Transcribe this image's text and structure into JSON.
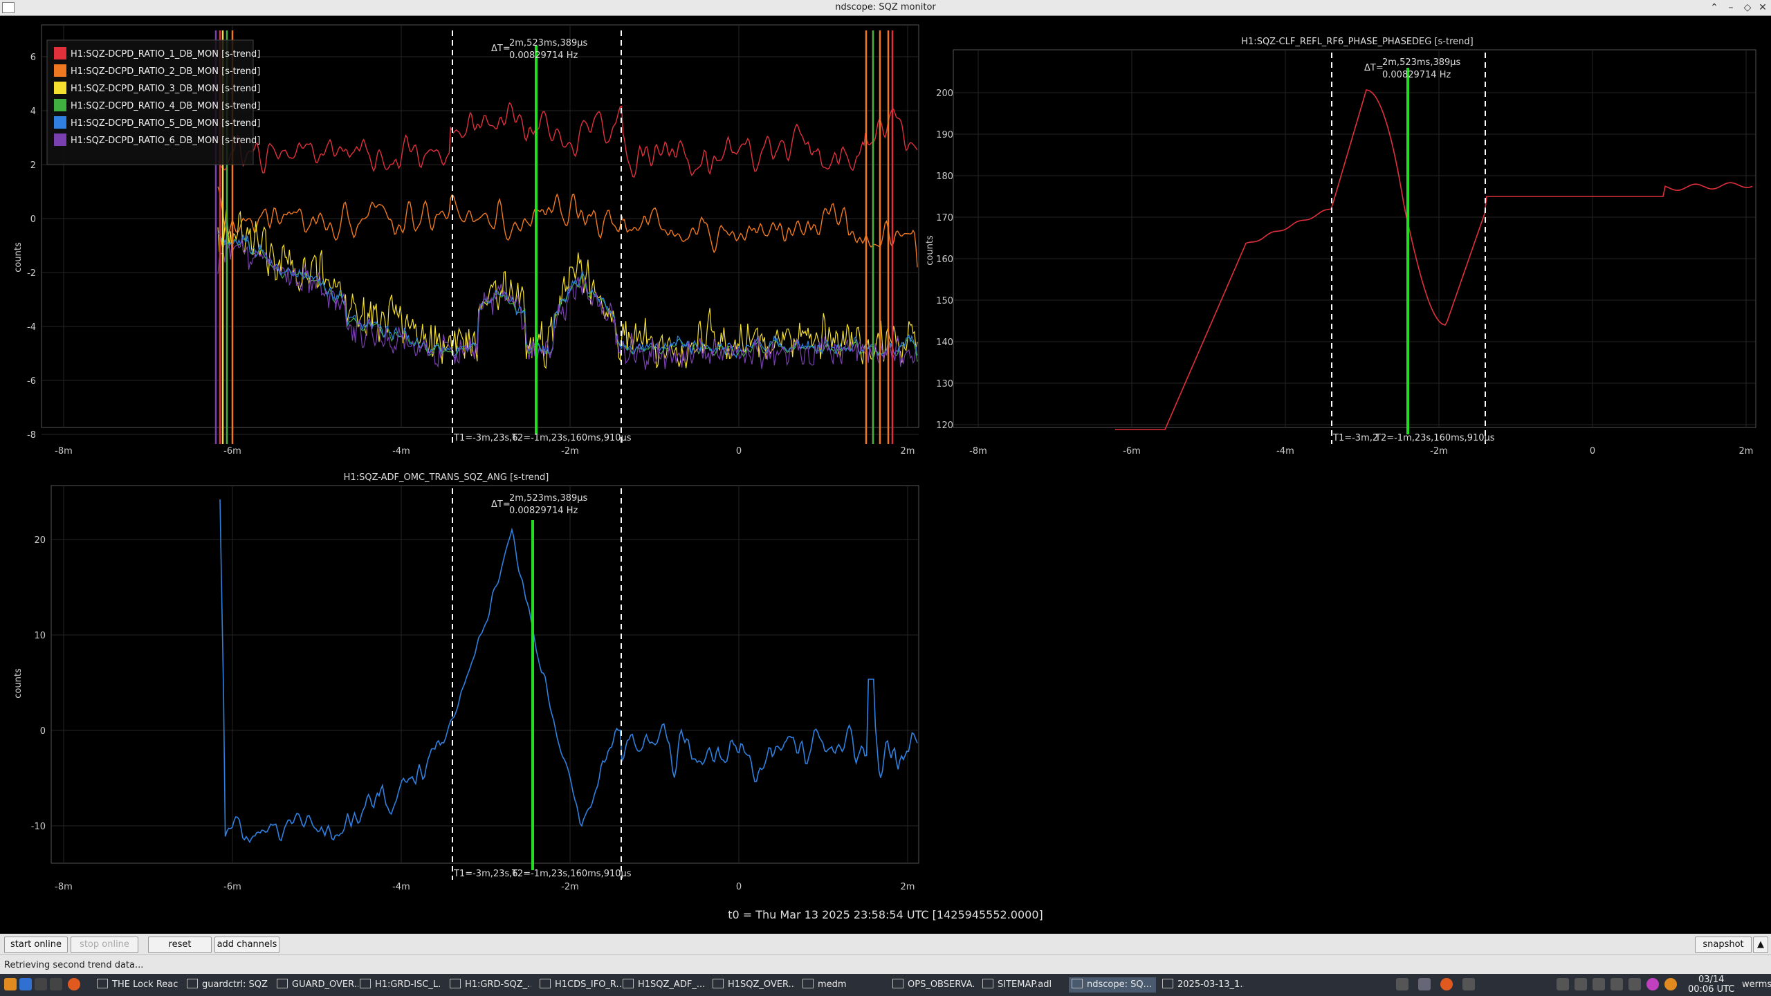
{
  "window": {
    "title": "ndscope: SQZ monitor"
  },
  "plots": {
    "p1": {
      "title": "",
      "ylabel": "counts",
      "legend": [
        {
          "label": "H1:SQZ-DCPD_RATIO_1_DB_MON [s-trend]",
          "color": "#e0303c"
        },
        {
          "label": "H1:SQZ-DCPD_RATIO_2_DB_MON [s-trend]",
          "color": "#f07820"
        },
        {
          "label": "H1:SQZ-DCPD_RATIO_3_DB_MON [s-trend]",
          "color": "#f5e030"
        },
        {
          "label": "H1:SQZ-DCPD_RATIO_4_DB_MON [s-trend]",
          "color": "#40b040"
        },
        {
          "label": "H1:SQZ-DCPD_RATIO_5_DB_MON [s-trend]",
          "color": "#2f80e0"
        },
        {
          "label": "H1:SQZ-DCPD_RATIO_6_DB_MON [s-trend]",
          "color": "#7a3fb0"
        }
      ],
      "yticks": [
        "6",
        "4",
        "2",
        "0",
        "-2",
        "-4",
        "-6",
        "-8"
      ],
      "xticks": [
        "-8m",
        "-6m",
        "-4m",
        "-2m",
        "0",
        "2m"
      ],
      "dt_label": "ΔT=",
      "dt_value": "2m,523ms,389µs",
      "dt_freq": "0.00829714 Hz",
      "t_label": "T1=-3m,23s,6",
      "t2_label": "T2=-1m,23s,160ms,910µs"
    },
    "p2": {
      "title": "H1:SQZ-CLF_REFL_RF6_PHASE_PHASEDEG [s-trend]",
      "ylabel": "counts",
      "yticks": [
        "200",
        "190",
        "180",
        "170",
        "160",
        "150",
        "140",
        "130",
        "120"
      ],
      "xticks": [
        "-8m",
        "-6m",
        "-4m",
        "-2m",
        "0",
        "2m"
      ],
      "dt_label": "ΔT=",
      "dt_value": "2m,523ms,389µs",
      "dt_freq": "0.00829714 Hz",
      "t_label": "T1=-3m,2",
      "t2_label": "T2=-1m,23s,160ms,910µs"
    },
    "p3": {
      "title": "H1:SQZ-ADF_OMC_TRANS_SQZ_ANG [s-trend]",
      "ylabel": "counts",
      "yticks": [
        "20",
        "10",
        "0",
        "-10"
      ],
      "xticks": [
        "-8m",
        "-6m",
        "-4m",
        "-2m",
        "0",
        "2m"
      ],
      "dt_label": "ΔT=",
      "dt_value": "2m,523ms,389µs",
      "dt_freq": "0.00829714 Hz",
      "t_label": "T1=-3m,23s,6",
      "t2_label": "T2=-1m,23s,160ms,910µs",
      "color": "#2f80e0"
    }
  },
  "t0_label": "t0 = Thu Mar 13 2025 23:58:54 UTC [1425945552.0000]",
  "buttons": {
    "start": "start online",
    "stop": "stop online",
    "reset": "reset",
    "add": "add channels",
    "snapshot": "snapshot"
  },
  "status": "Retrieving second trend data...",
  "taskbar": {
    "items": [
      "THE Lock Reac...",
      "guardctrl: SQZ...",
      "GUARD_OVER...",
      "H1:GRD-ISC_L...",
      "H1:GRD-SQZ_...",
      "H1CDS_IFO_R...",
      "H1SQZ_ADF_...",
      "H1SQZ_OVER...",
      "medm",
      "OPS_OBSERVA...",
      "SITEMAP.adl",
      "ndscope: SQ...",
      "2025-03-13_1..."
    ],
    "clock_date": "03/14",
    "clock_time": "00:06 UTC",
    "user": "werms"
  }
}
